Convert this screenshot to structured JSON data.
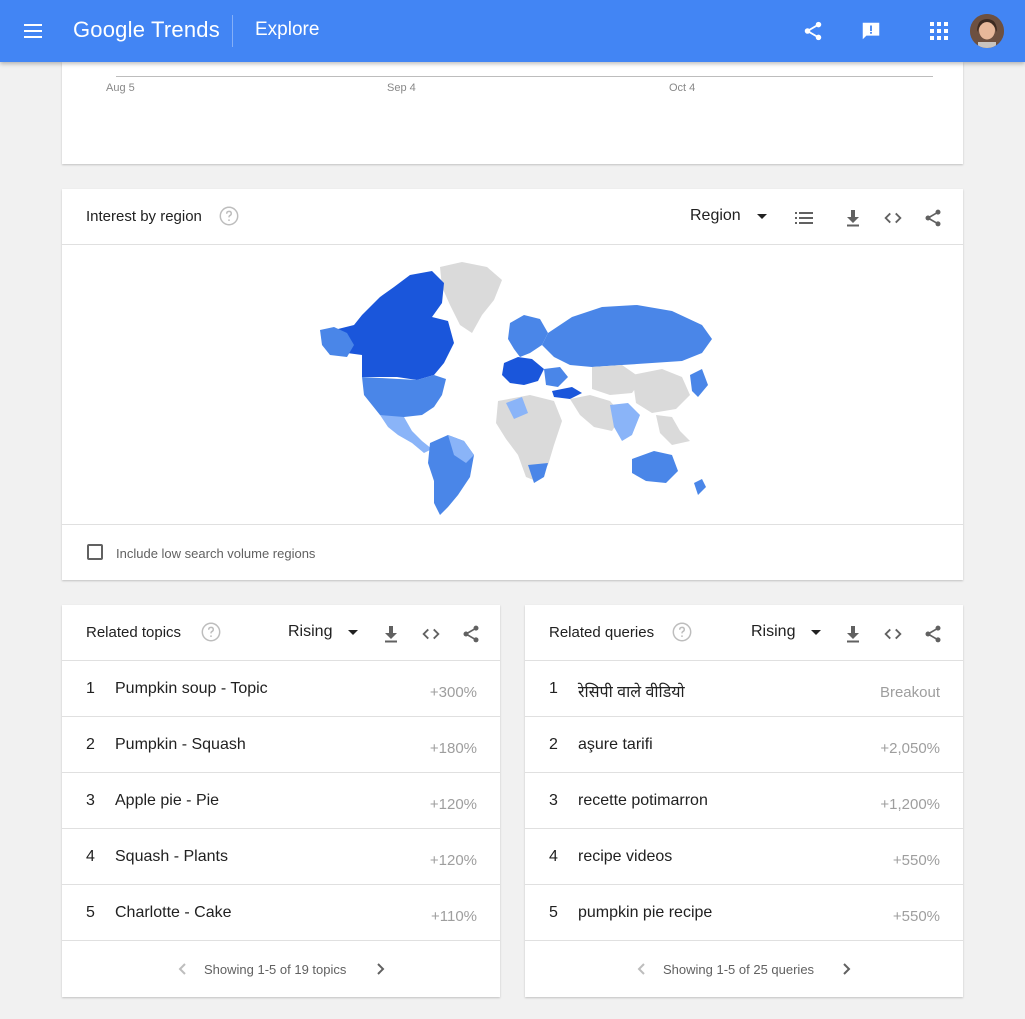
{
  "header": {
    "logo_text": "Google Trends",
    "section": "Explore",
    "icons": [
      "menu-icon",
      "share-icon",
      "feedback-icon",
      "apps-icon",
      "avatar"
    ]
  },
  "timeline": {
    "x_labels": [
      "Aug 5",
      "Sep 4",
      "Oct 4"
    ]
  },
  "region_card": {
    "title": "Interest by region",
    "dropdown": "Region",
    "checkbox_label": "Include low search volume regions"
  },
  "topics": {
    "title": "Related topics",
    "dropdown": "Rising",
    "items": [
      {
        "rank": "1",
        "label": "Pumpkin soup - Topic",
        "value": "+300%"
      },
      {
        "rank": "2",
        "label": "Pumpkin - Squash",
        "value": "+180%"
      },
      {
        "rank": "3",
        "label": "Apple pie - Pie",
        "value": "+120%"
      },
      {
        "rank": "4",
        "label": "Squash - Plants",
        "value": "+120%"
      },
      {
        "rank": "5",
        "label": "Charlotte - Cake",
        "value": "+110%"
      }
    ],
    "pager": "Showing 1-5 of 19 topics"
  },
  "queries": {
    "title": "Related queries",
    "dropdown": "Rising",
    "items": [
      {
        "rank": "1",
        "label": "रेसिपी वाले वीडियो",
        "value": "Breakout"
      },
      {
        "rank": "2",
        "label": "aşure tarifi",
        "value": "+2,050%"
      },
      {
        "rank": "3",
        "label": "recette potimarron",
        "value": "+1,200%"
      },
      {
        "rank": "4",
        "label": "recipe videos",
        "value": "+550%"
      },
      {
        "rank": "5",
        "label": "pumpkin pie recipe",
        "value": "+550%"
      }
    ],
    "pager": "Showing 1-5 of 25 queries"
  },
  "colors": {
    "brand": "#4285f4",
    "map_high": "#1a56db",
    "map_mid": "#4a86e8",
    "map_low": "#8ab4f8",
    "map_none": "#dadada"
  }
}
